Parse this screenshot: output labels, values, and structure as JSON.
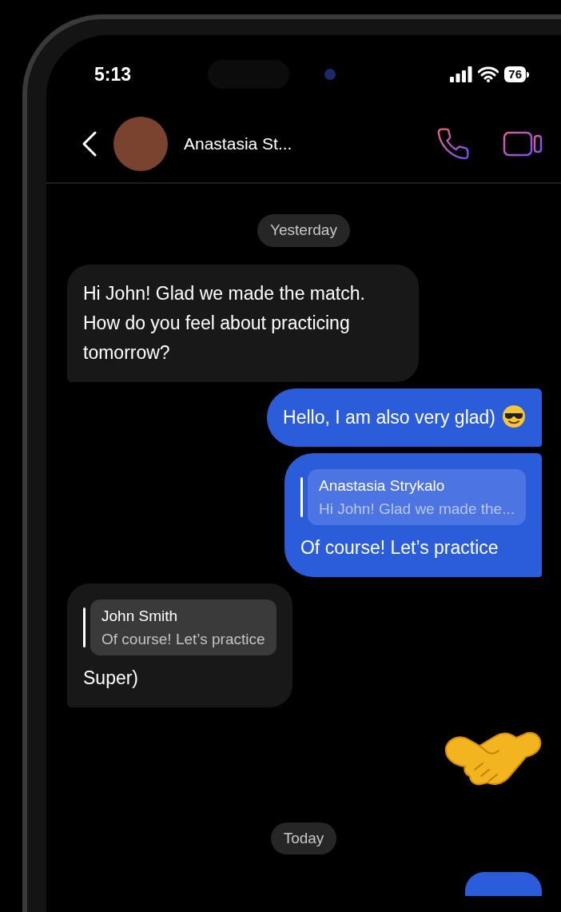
{
  "status_bar": {
    "time": "5:13",
    "battery": "76"
  },
  "header": {
    "contact_name": "Anastasia St..."
  },
  "messages": [
    {
      "kind": "date",
      "text": "Yesterday"
    },
    {
      "kind": "text",
      "outgoing": false,
      "text": "Hi John! Glad we made the match. How do you feel about practicing tomorrow?"
    },
    {
      "kind": "text",
      "outgoing": true,
      "text": "Hello, I am also very glad)",
      "emoji": true
    },
    {
      "kind": "reply",
      "outgoing": true,
      "quote_author": "Anastasia Strykalo",
      "quote_text": "Hi John! Glad we made the...",
      "text": "Of course! Let’s practice"
    },
    {
      "kind": "reply",
      "outgoing": false,
      "quote_author": "John Smith",
      "quote_text": "Of course! Let’s practice",
      "text": "Super)"
    },
    {
      "kind": "sticker",
      "outgoing": true
    },
    {
      "kind": "date",
      "text": "Today"
    }
  ]
}
